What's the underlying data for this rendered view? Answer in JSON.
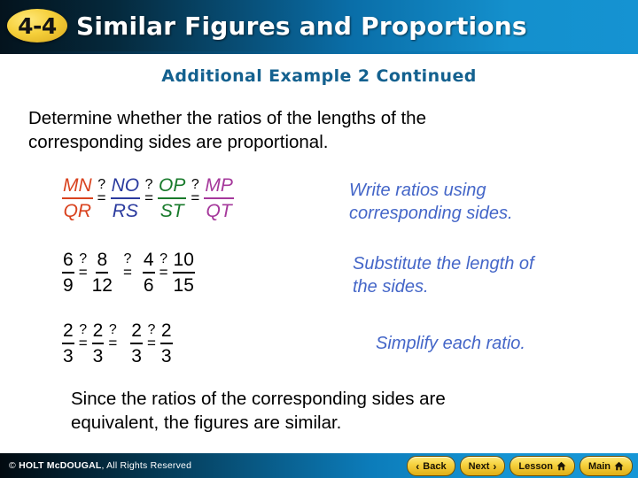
{
  "header": {
    "lesson_number": "4-4",
    "title": "Similar Figures and Proportions"
  },
  "subtitle": "Additional Example 2 Continued",
  "prompt_text": "Determine whether the ratios of the lengths of the\ncorresponding sides are proportional.",
  "conclusion_text": "Since the ratios of the corresponding sides are\nequivalent, the figures are similar.",
  "relation_symbol": {
    "question": "?",
    "equals": "="
  },
  "ratios": {
    "letters": [
      {
        "numerator": "MN",
        "denominator": "QR",
        "color": "#d9431f"
      },
      {
        "numerator": "NO",
        "denominator": "RS",
        "color": "#2a3a9e"
      },
      {
        "numerator": "OP",
        "denominator": "ST",
        "color": "#187a2b"
      },
      {
        "numerator": "MP",
        "denominator": "QT",
        "color": "#a5389b"
      }
    ],
    "numbers": [
      {
        "numerator": "6",
        "denominator": "9",
        "color": "#000000"
      },
      {
        "numerator": "8",
        "denominator": "12",
        "color": "#000000"
      },
      {
        "numerator": "4",
        "denominator": "6",
        "color": "#000000"
      },
      {
        "numerator": "10",
        "denominator": "15",
        "color": "#000000"
      }
    ],
    "simplified": [
      {
        "numerator": "2",
        "denominator": "3",
        "color": "#000000"
      },
      {
        "numerator": "2",
        "denominator": "3",
        "color": "#000000"
      },
      {
        "numerator": "2",
        "denominator": "3",
        "color": "#000000"
      },
      {
        "numerator": "2",
        "denominator": "3",
        "color": "#000000"
      }
    ]
  },
  "annotations": {
    "step1": "Write ratios using\ncorresponding sides.",
    "step2": "Substitute the length of\nthe sides.",
    "step3": "Simplify each ratio."
  },
  "footer": {
    "copyright_symbol": "©",
    "copyright_brand": "HOLT McDOUGAL",
    "copyright_rest": ", All Rights Reserved",
    "buttons": [
      {
        "label": "Back",
        "icon": "chevron-left-icon"
      },
      {
        "label": "Next",
        "icon": "chevron-right-icon"
      },
      {
        "label": "Lesson",
        "icon": "home-icon"
      },
      {
        "label": "Main",
        "icon": "home-icon"
      }
    ]
  },
  "colors": {
    "header_dark": "#04131d",
    "header_bright": "#1593d2",
    "subtitle": "#14618f",
    "annotation": "#4466c8",
    "badge": "#f5cf3a",
    "button": "#f6d23f"
  }
}
